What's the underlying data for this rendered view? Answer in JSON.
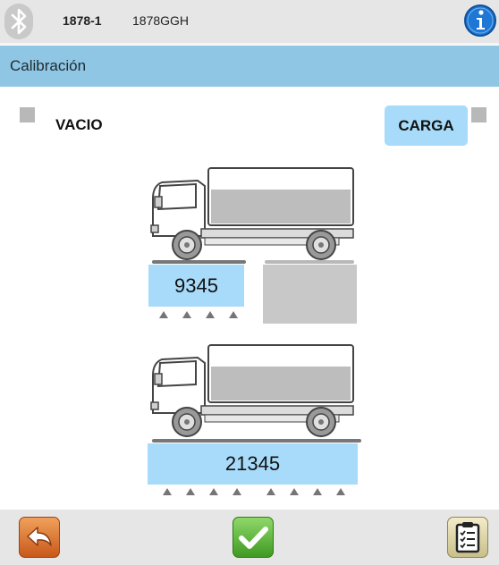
{
  "header": {
    "device_id": "1878-1",
    "plate": "1878GGH"
  },
  "section": {
    "title": "Calibración"
  },
  "modes": {
    "empty_label": "VACIO",
    "load_button": "CARGA"
  },
  "weights": {
    "front_axle": "9345",
    "total": "21345"
  },
  "icons": {
    "bluetooth": "bluetooth-icon",
    "info": "info-icon",
    "back": "back-arrow-icon",
    "confirm": "check-icon",
    "report": "clipboard-icon"
  },
  "colors": {
    "header_bar": "#8fc6e3",
    "weight_box": "#a8dbf9",
    "toolbar": "#e6e6e6",
    "back_button": "#d8691e",
    "confirm_button": "#5cb835",
    "info_button": "#1e77d4"
  }
}
